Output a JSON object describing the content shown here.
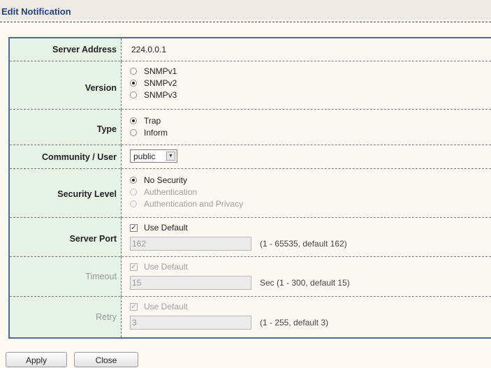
{
  "title": "Edit Notification",
  "server_address": {
    "label": "Server Address",
    "value": "224.0.0.1"
  },
  "version": {
    "label": "Version",
    "options": [
      {
        "label": "SNMPv1",
        "selected": false
      },
      {
        "label": "SNMPv2",
        "selected": true
      },
      {
        "label": "SNMPv3",
        "selected": false
      }
    ]
  },
  "type": {
    "label": "Type",
    "options": [
      {
        "label": "Trap",
        "selected": true
      },
      {
        "label": "Inform",
        "selected": false
      }
    ]
  },
  "community": {
    "label": "Community / User",
    "value": "public"
  },
  "security_level": {
    "label": "Security Level",
    "options": [
      {
        "label": "No Security",
        "selected": true,
        "enabled": true
      },
      {
        "label": "Authentication",
        "selected": false,
        "enabled": false
      },
      {
        "label": "Authentication and Privacy",
        "selected": false,
        "enabled": false
      }
    ]
  },
  "server_port": {
    "label": "Server Port",
    "use_default_label": "Use Default",
    "use_default_checked": true,
    "value": "162",
    "hint": "(1 - 65535, default 162)"
  },
  "timeout": {
    "label": "Timeout",
    "use_default_label": "Use Default",
    "use_default_checked": true,
    "value": "15",
    "hint": "Sec (1 - 300, default 15)"
  },
  "retry": {
    "label": "Retry",
    "use_default_label": "Use Default",
    "use_default_checked": true,
    "value": "3",
    "hint": "(1 - 255, default 3)"
  },
  "buttons": {
    "apply": "Apply",
    "close": "Close"
  }
}
